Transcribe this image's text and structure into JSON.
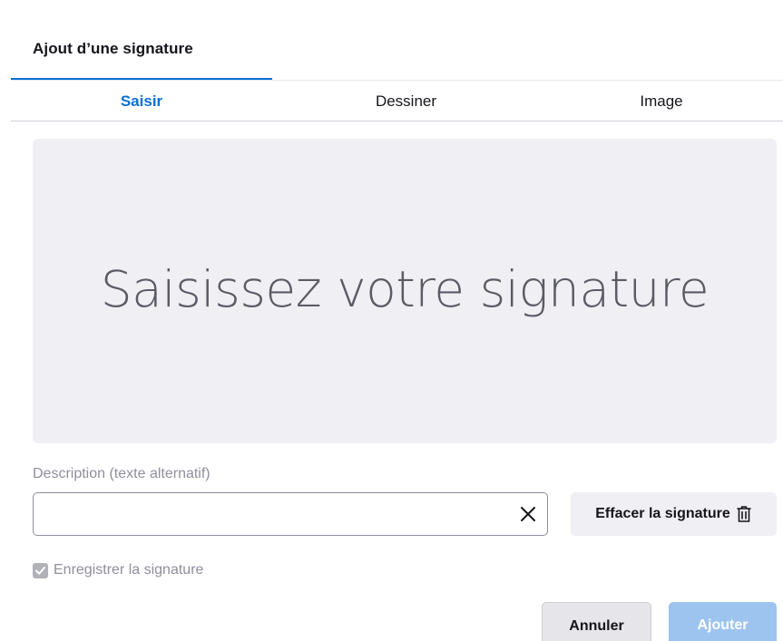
{
  "dialog": {
    "title": "Ajout d’une signature"
  },
  "tabs": [
    {
      "label": "Saisir",
      "active": true
    },
    {
      "label": "Dessiner",
      "active": false
    },
    {
      "label": "Image",
      "active": false
    }
  ],
  "signature_area": {
    "placeholder": "Saisissez votre signature"
  },
  "description": {
    "label": "Description (texte alternatif)",
    "value": "",
    "clear_icon": "close-icon"
  },
  "erase_button": {
    "label": "Effacer la signature",
    "icon": "trash-icon"
  },
  "save_option": {
    "label": "Enregistrer la signature",
    "checked": true,
    "disabled": true
  },
  "footer": {
    "cancel_label": "Annuler",
    "add_label": "Ajouter"
  },
  "colors": {
    "accent": "#0b6fd4",
    "add_button_disabled": "#9dc4ef",
    "signature_background": "#f0f0f4"
  }
}
